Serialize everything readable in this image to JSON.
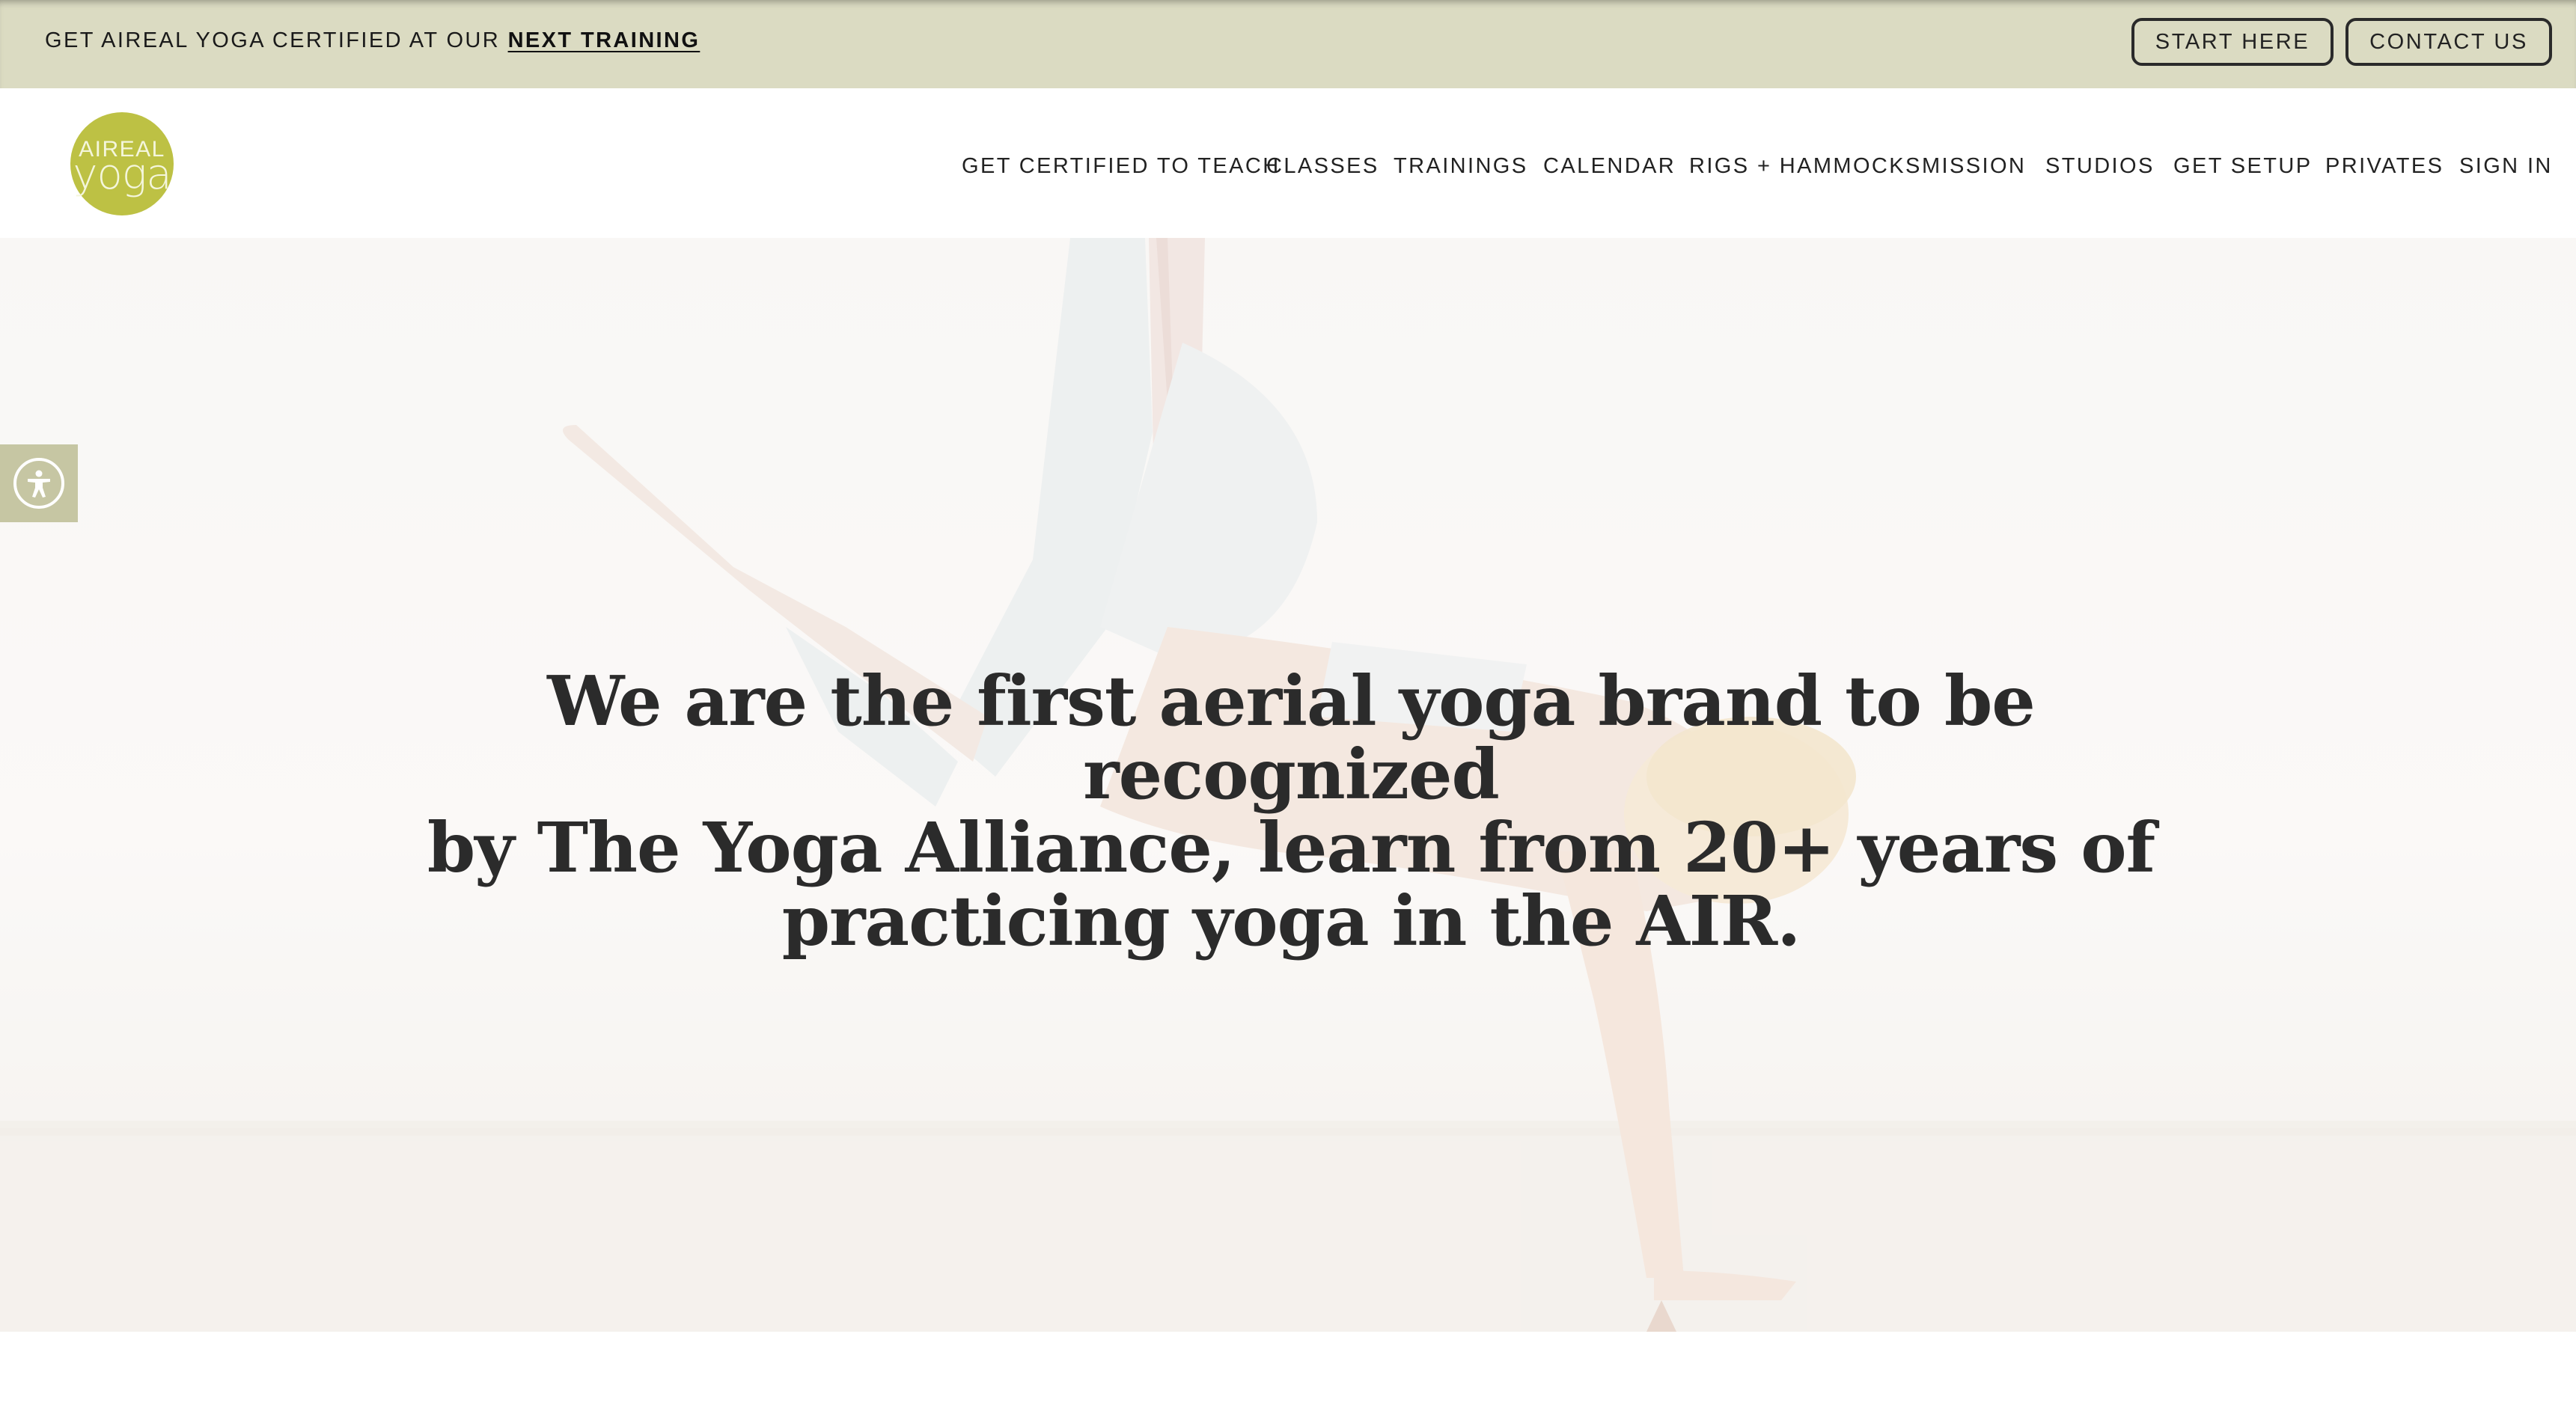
{
  "announcement": {
    "text": "GET AIREAL YOGA CERTIFIED AT OUR",
    "link": "NEXT TRAINING",
    "buttons": [
      "START HERE",
      "CONTACT US"
    ]
  },
  "brand": {
    "logo_line1": "AIREAL",
    "logo_line2": "yoga",
    "accent": "#bdc144",
    "bar_bg": "#dbdbc2"
  },
  "nav": {
    "items": [
      "GET CERTIFIED TO TEACH",
      "CLASSES",
      "TRAININGS",
      "CALENDAR",
      "RIGS + HAMMOCKS",
      "MISSION",
      "STUDIOS",
      "GET SETUP",
      "PRIVATES",
      "SIGN IN"
    ]
  },
  "hero": {
    "line1": "We are the first aerial yoga brand to be recognized",
    "line2": "by The Yoga Alliance,  learn from 20+ years of",
    "line3": "practicing yoga in the AIR."
  },
  "accessibility": {
    "icon": "accessibility-icon"
  }
}
